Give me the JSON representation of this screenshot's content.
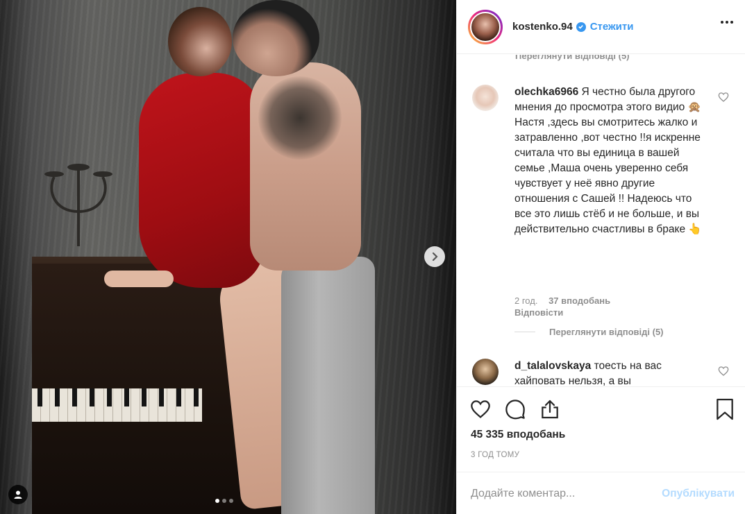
{
  "post": {
    "author": "kostenko.94",
    "follow_label": "Стежити",
    "likes": "45 335 вподобань",
    "time_ago": "3 год тому"
  },
  "comments": [
    {
      "user": "olechka6966",
      "text": "Я честно была другого мнения до просмотра этого видио 🙊Настя ,здесь вы смотритесь жалко и затравленно ,вот честно !!я искренне считала что вы единица в вашей семье ,Маша очень уверенно себя чувствует у неё явно другие отношения с Сашей !! Надеюсь что все это лишь стёб и не больше, и вы действительно счастливы в браке 👆",
      "time": "2 год.",
      "likes": "37 вподобань",
      "reply": "Відповісти",
      "view_replies": "Переглянути відповіді (5)"
    },
    {
      "user": "d_talalovskaya",
      "text": "тоесть на вас хайповать нельзя, а вы"
    }
  ],
  "prev_view_replies": "Переглянути відповіді (5)",
  "comment_box": {
    "placeholder": "Додайте коментар...",
    "post_label": "Опублікувати"
  },
  "icons": {
    "like": "heart-icon",
    "comment": "comment-icon",
    "share": "share-icon",
    "save": "bookmark-icon",
    "more": "more-icon",
    "next": "chevron-right-icon",
    "tag": "user-tag-icon"
  },
  "carousel": {
    "slides": 3,
    "active": 1
  },
  "colors": {
    "accent": "#3897f0",
    "post_disabled": "#b3dbff",
    "muted": "#8e8e8e",
    "text": "#262626"
  }
}
